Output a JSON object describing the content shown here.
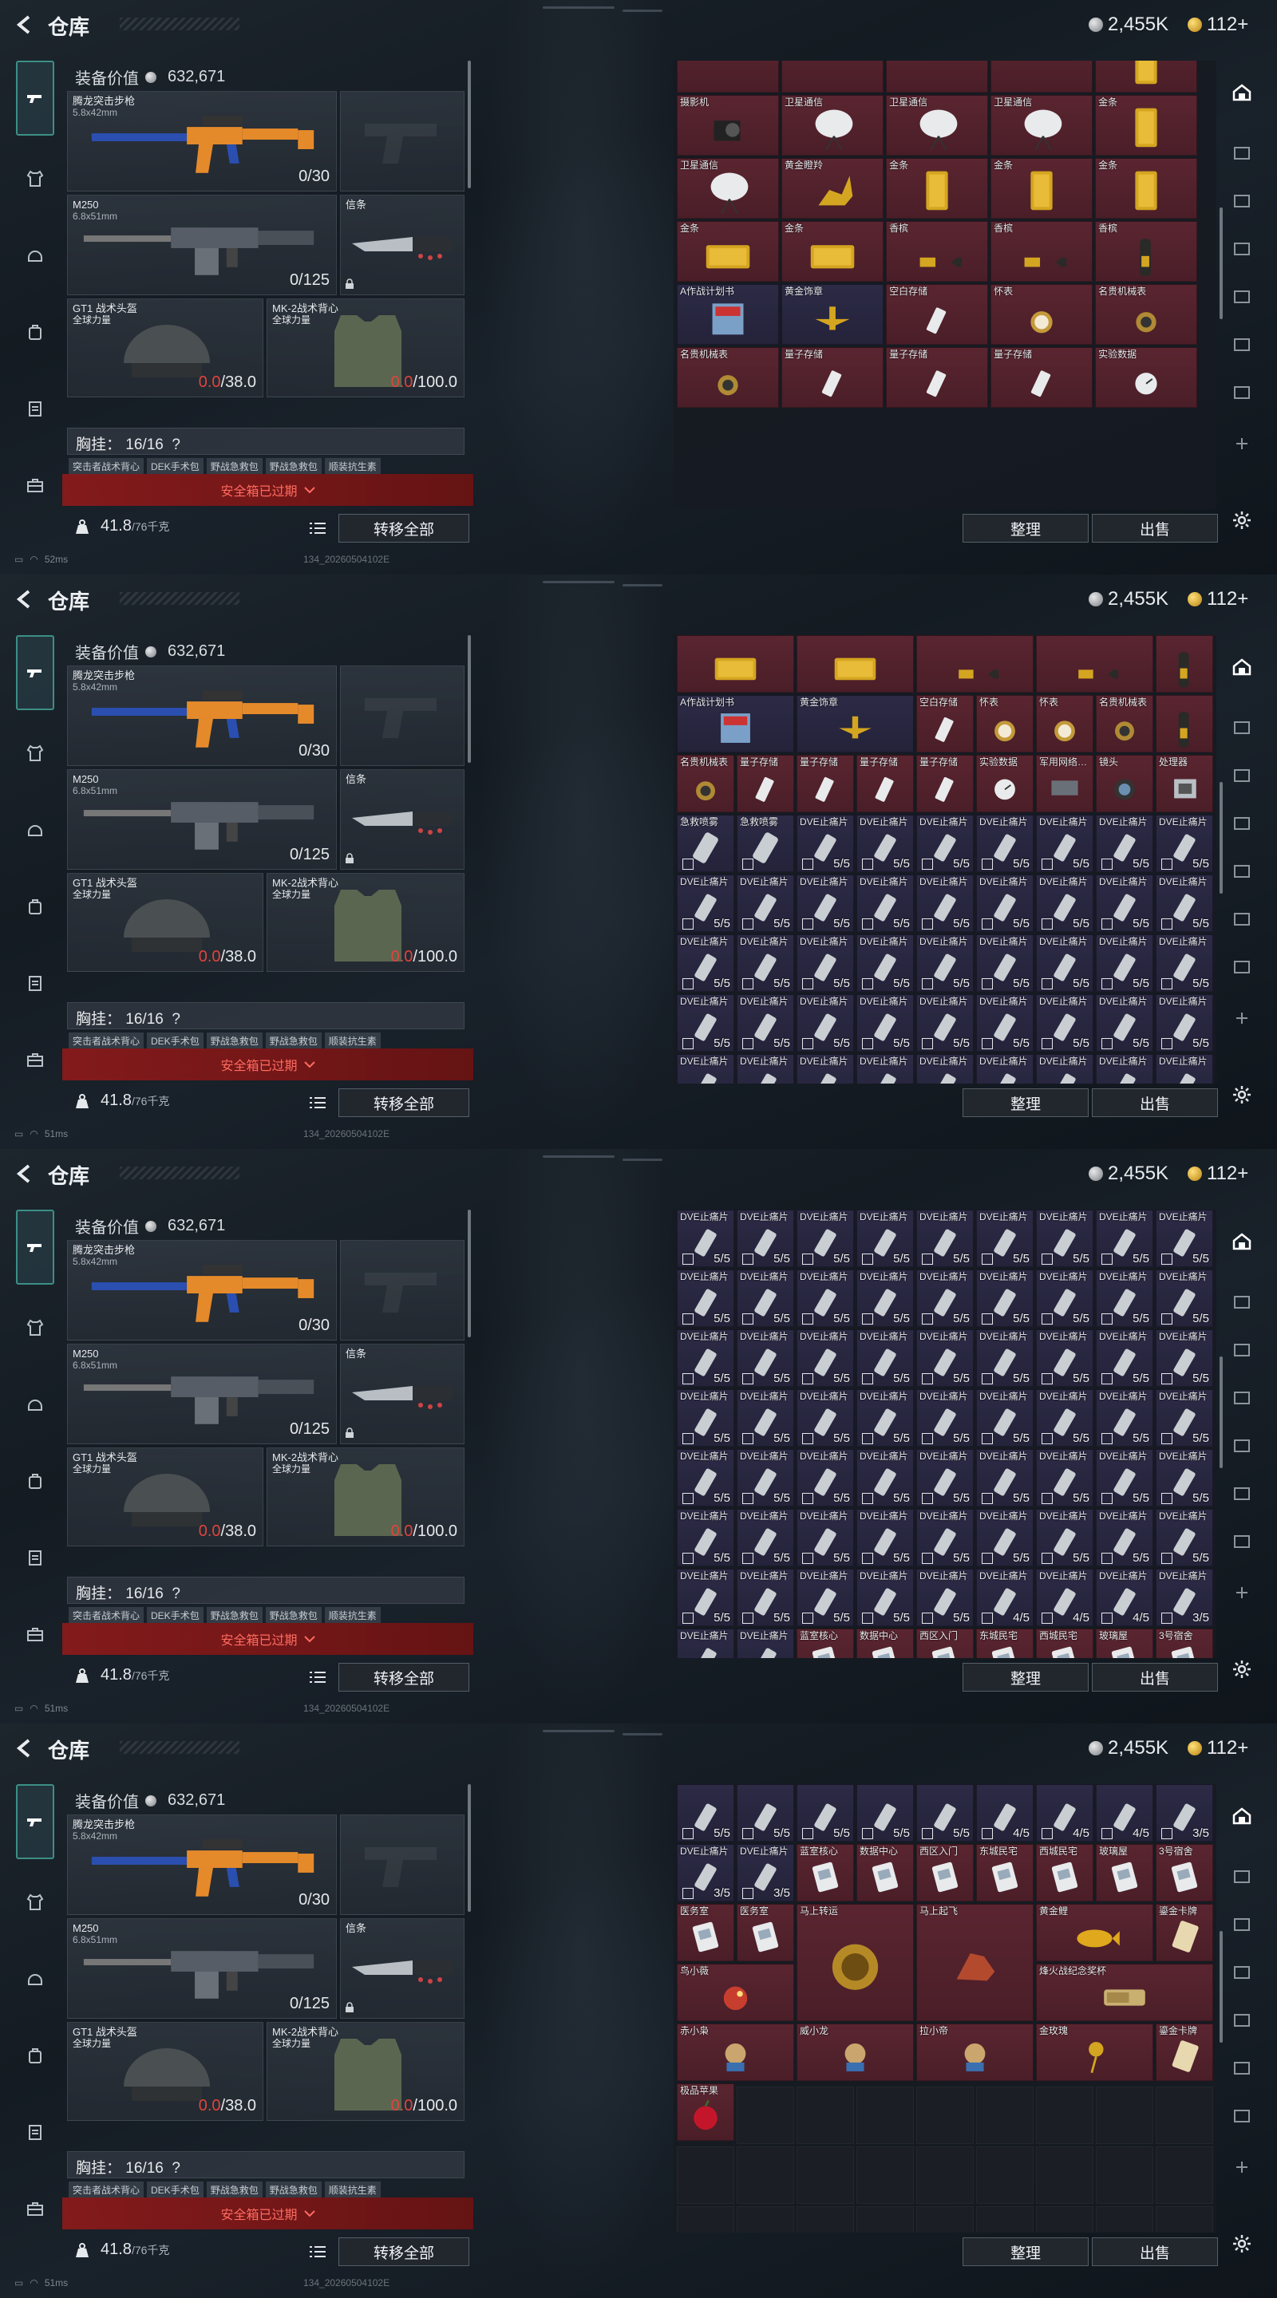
{
  "header": {
    "title": "仓库",
    "silver": "2,455K",
    "gold": "112+"
  },
  "equipment": {
    "value_label": "装备价值",
    "value": "632,671",
    "primary": {
      "name": "腾龙突击步枪",
      "caliber": "5.8x42mm",
      "count": "0/30"
    },
    "secondary": {
      "name": "M250",
      "caliber": "6.8x51mm",
      "count": "0/125"
    },
    "melee": {
      "name": "信条"
    },
    "helmet": {
      "name": "GT1 战术头盔",
      "brand": "全球力量",
      "dur": "0.0",
      "max": "/38.0"
    },
    "armor": {
      "name": "MK-2战术背心",
      "brand": "全球力量",
      "dur": "0.0",
      "max": "/100.0"
    },
    "pouch": {
      "label": "胸挂：",
      "count": "16/16",
      "help": "?"
    },
    "tags": [
      "突击者战术背心",
      "DEK手术包",
      "野战急救包",
      "野战急救包",
      "顺装抗生素"
    ],
    "expired": "安全箱已过期",
    "weight": "41.8",
    "weight_max": "/76千克",
    "transfer": "转移全部"
  },
  "status": [
    {
      "ping": "52ms",
      "build": "134_20260504102E"
    },
    {
      "ping": "51ms",
      "build": "134_20260504102E"
    },
    {
      "ping": "51ms",
      "build": "134_20260504102E"
    },
    {
      "ping": "51ms",
      "build": "134_20260504102E"
    }
  ],
  "grid_actions": {
    "sort": "整理",
    "sell": "出售"
  },
  "labels": {
    "camera": "摄影机",
    "sat": "卫星通信",
    "gold": "金条",
    "fawn": "黄金瞪羚",
    "champ": "香槟",
    "guide": "A作战计划书",
    "ornament": "黄金饰章",
    "ssd": "空白存储",
    "watch": "怀表",
    "mech": "名贵机械表",
    "qssd": "量子存储",
    "exp": "实验数据",
    "mil": "军用网络…",
    "lens": "镜头",
    "proc": "处理器",
    "spray": "急救喷雾",
    "dve": "DVE止痛片",
    "blue": "蓝室核心",
    "data": "数据中心",
    "xi": "西区入门",
    "dong": "东城民宅",
    "xicheng": "西城民宅",
    "glass": "玻璃屋",
    "room3": "3号宿舍",
    "med": "医务室",
    "horse": "马上转运",
    "fly": "马上起飞",
    "carp": "黄金鲤",
    "cert": "鎏金卡牌",
    "bird": "鸟小薇",
    "torch": "烽火战纪念奖杯",
    "chibi": "赤小枭",
    "weixiao": "威小龙",
    "laxiao": "拉小帝",
    "rose": "金玫瑰",
    "apple": "极品苹果",
    "q55": "5/5",
    "q45": "4/5",
    "q35": "3/5"
  }
}
